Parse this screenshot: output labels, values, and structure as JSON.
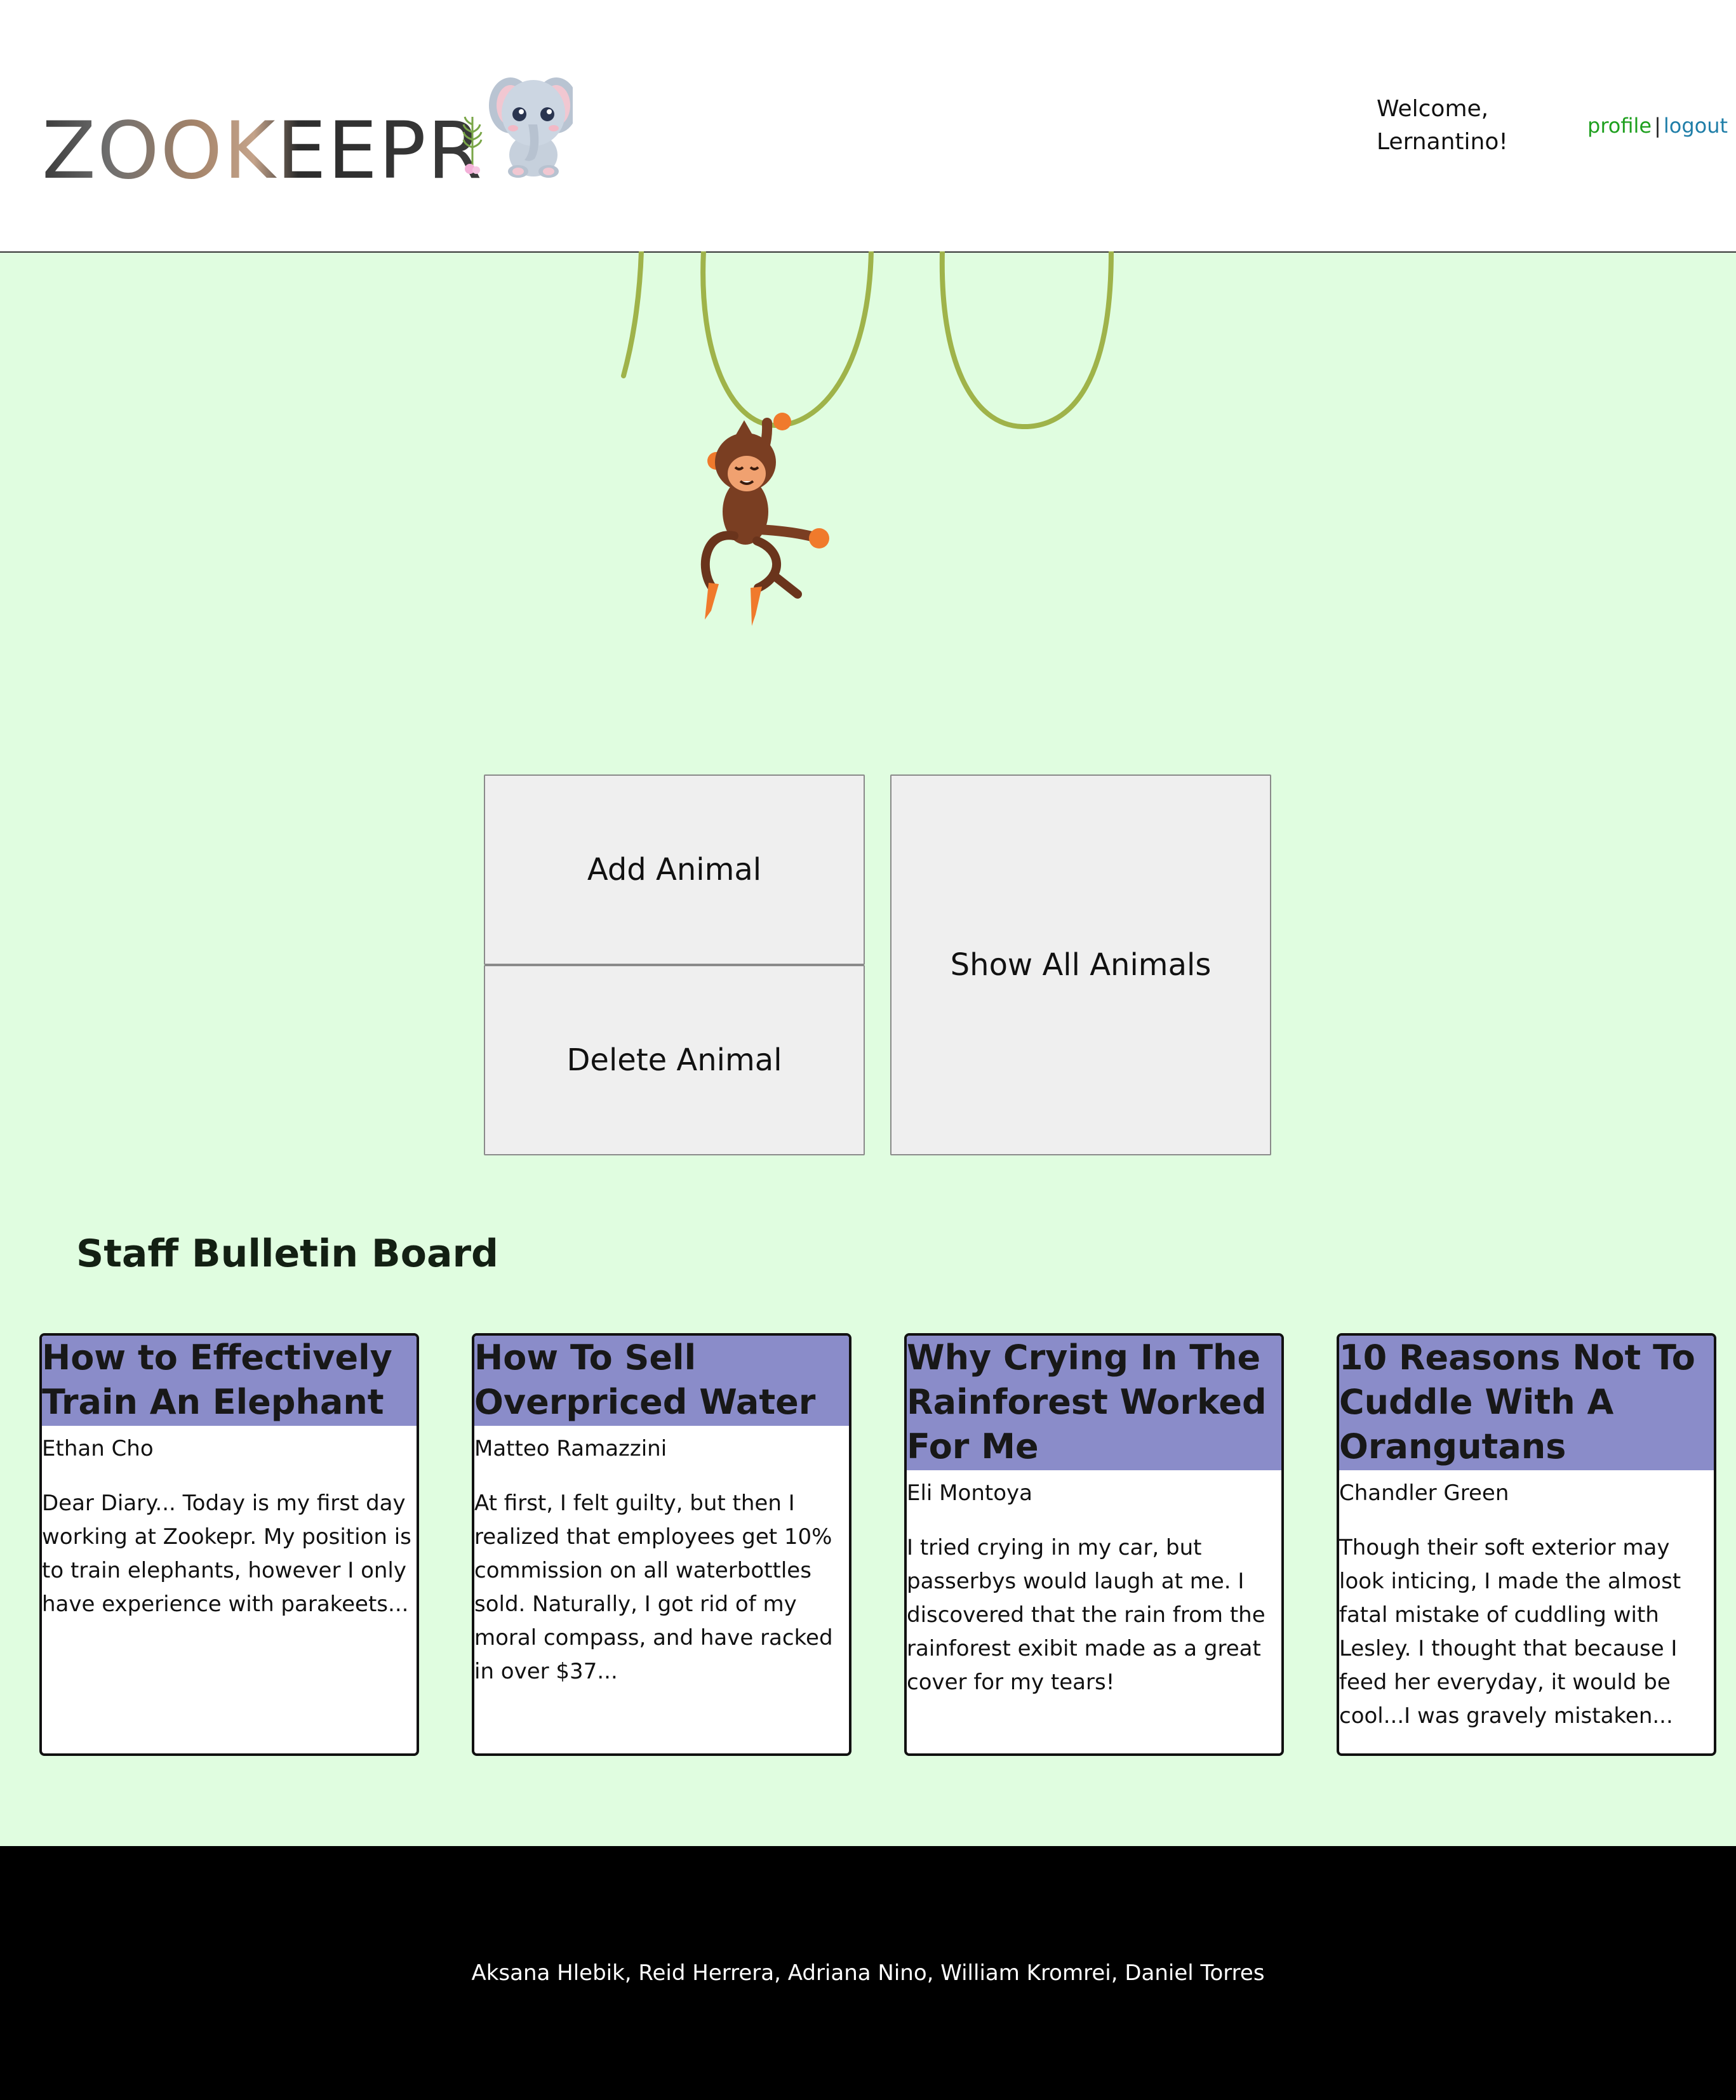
{
  "header": {
    "logo_text": "ZOOKEEPR",
    "welcome_line1": "Welcome,",
    "welcome_line2": "Lernantino!",
    "profile_label": "profile",
    "separator": "|",
    "logout_label": "logout"
  },
  "actions": {
    "add_label": "Add Animal",
    "delete_label": "Delete Animal",
    "show_label": "Show All Animals"
  },
  "bulletin": {
    "title": "Staff Bulletin Board",
    "posts": [
      {
        "title": "How to Effectively Train An Elephant",
        "author": "Ethan Cho",
        "body": "Dear Diary... Today is my first day working at Zookepr. My position is to train elephants, however I only have experience with parakeets..."
      },
      {
        "title": "How To Sell Overpriced Water",
        "author": "Matteo Ramazzini",
        "body": "At first, I felt guilty, but then I realized that employees get 10% commission on all waterbottles sold. Naturally, I got rid of my moral compass, and have racked in over $37..."
      },
      {
        "title": "Why Crying In The Rainforest Worked For Me",
        "author": "Eli Montoya",
        "body": "I tried crying in my car, but passerbys would laugh at me. I discovered that the rain from the rainforest exibit made as a great cover for my tears!"
      },
      {
        "title": "10 Reasons Not To Cuddle With A Orangutans",
        "author": "Chandler Green",
        "body": "Though their soft exterior may look inticing, I made the almost fatal mistake of cuddling with Lesley. I thought that because I feed her everyday, it would be cool...I was gravely mistaken..."
      }
    ]
  },
  "footer": {
    "credits": "Aksana Hlebik, Reid Herrera, Adriana Nino, William Kromrei, Daniel Torres"
  },
  "colors": {
    "page_background": "#e0fde0",
    "card_header": "#8a8cc9",
    "profile_link": "#1fa01f",
    "logout_link": "#1f7ea8",
    "button_background": "#efefef",
    "footer_background": "#000000"
  },
  "icons": {
    "logo_mascot": "elephant-icon",
    "hero_illustration": "monkey-on-vines-illustration"
  }
}
